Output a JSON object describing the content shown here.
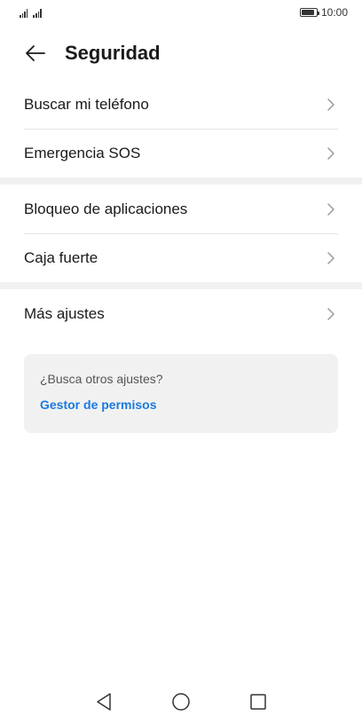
{
  "status_bar": {
    "time": "10:00",
    "signal_icons": [
      "signal-icon",
      "signal-icon"
    ],
    "battery_level": 0.9
  },
  "header": {
    "back_icon": "arrow-left-icon",
    "title": "Seguridad"
  },
  "groups": [
    {
      "items": [
        {
          "label": "Buscar mi teléfono",
          "icon": "chevron-right-icon"
        },
        {
          "label": "Emergencia SOS",
          "icon": "chevron-right-icon"
        }
      ]
    },
    {
      "items": [
        {
          "label": "Bloqueo de aplicaciones",
          "icon": "chevron-right-icon"
        },
        {
          "label": "Caja fuerte",
          "icon": "chevron-right-icon"
        }
      ]
    },
    {
      "items": [
        {
          "label": "Más ajustes",
          "icon": "chevron-right-icon"
        }
      ]
    }
  ],
  "suggestion_card": {
    "hint": "¿Busca otros ajustes?",
    "link": "Gestor de permisos"
  },
  "nav_bar": {
    "buttons": [
      "back-triangle-icon",
      "home-circle-icon",
      "recents-square-icon"
    ]
  },
  "colors": {
    "background": "#ffffff",
    "text": "#1a1a1a",
    "divider": "#e4e4e4",
    "section_gap": "#f1f1f1",
    "link": "#1b7ae0"
  }
}
